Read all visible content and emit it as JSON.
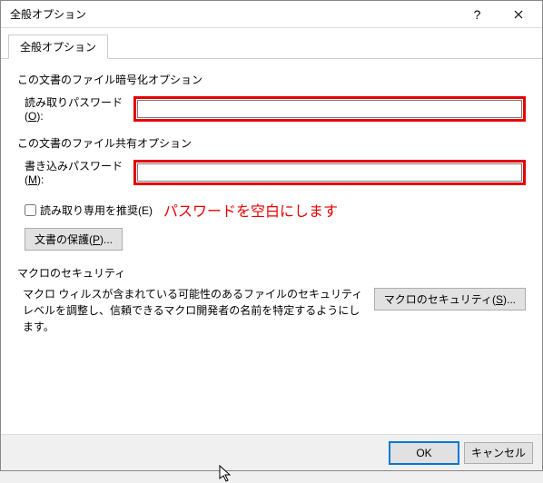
{
  "window": {
    "title": "全般オプション"
  },
  "tabs": {
    "general": "全般オプション"
  },
  "groups": {
    "encryption": {
      "label": "この文書のファイル暗号化オプション",
      "read_password_label_pre": "読み取りパスワード(",
      "read_password_accel": "O",
      "read_password_label_post": "):",
      "read_password_value": ""
    },
    "sharing": {
      "label": "この文書のファイル共有オプション",
      "write_password_label_pre": "書き込みパスワード(",
      "write_password_accel": "M",
      "write_password_label_post": "):",
      "write_password_value": ""
    },
    "readonly": {
      "label_pre": "読み取り専用を推奨(",
      "accel": "E",
      "label_post": ")"
    },
    "protect": {
      "label_pre": "文書の保護(",
      "accel": "P",
      "label_post": ")..."
    },
    "macro": {
      "section_label": "マクロのセキュリティ",
      "text": "マクロ ウィルスが含まれている可能性のあるファイルのセキュリティ レベルを調整し、信頼できるマクロ開発者の名前を特定するようにします。",
      "button_pre": "マクロのセキュリティ(",
      "button_accel": "S",
      "button_post": ")..."
    }
  },
  "annotation": "パスワードを空白にします",
  "footer": {
    "ok": "OK",
    "cancel": "キャンセル"
  }
}
